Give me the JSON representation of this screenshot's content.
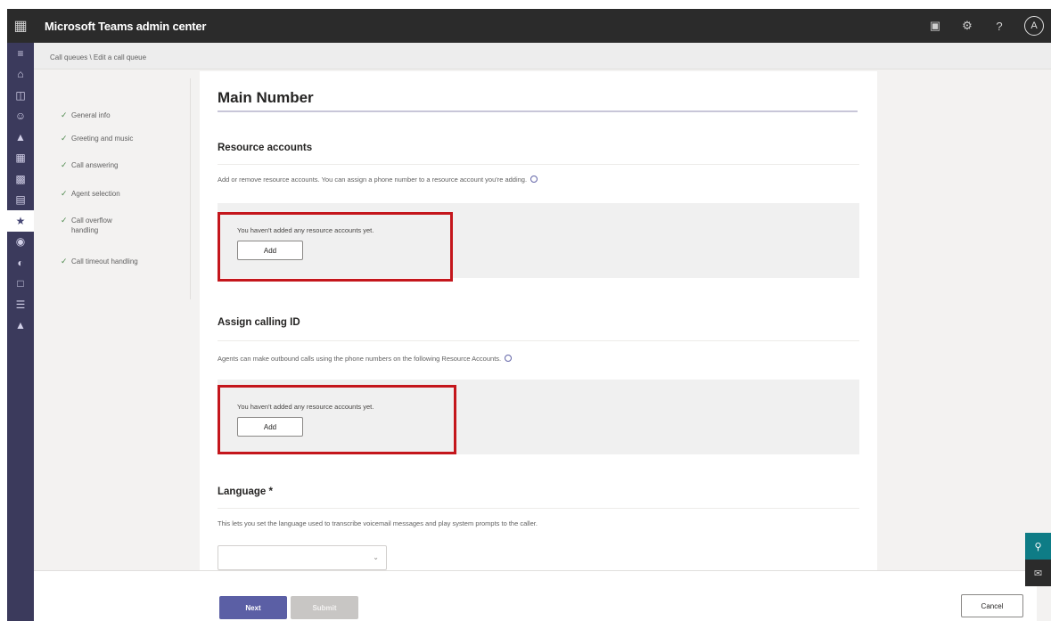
{
  "app": {
    "title": "Microsoft Teams admin center",
    "avatar_initial": "A"
  },
  "breadcrumb": "Call queues \\ Edit a call queue",
  "steps": [
    {
      "label": "General info"
    },
    {
      "label": "Greeting and music"
    },
    {
      "label": "Call answering"
    },
    {
      "label": "Agent selection"
    },
    {
      "label": "Call overflow handling"
    },
    {
      "label": "Call timeout handling"
    }
  ],
  "main": {
    "title": "Main Number",
    "resource_accounts": {
      "heading": "Resource accounts",
      "description": "Add or remove resource accounts. You can assign a phone number to a resource account you're adding.",
      "empty_text": "You haven't added any resource accounts yet.",
      "add_label": "Add"
    },
    "calling_id": {
      "heading": "Assign calling ID",
      "description": "Agents can make outbound calls using the phone numbers on the following Resource Accounts.",
      "empty_text": "You haven't added any resource accounts yet.",
      "add_label": "Add"
    },
    "language": {
      "heading": "Language *",
      "description": "This lets you set the language used to transcribe voicemail messages and play system prompts to the caller.",
      "selected": ""
    }
  },
  "footer": {
    "next_label": "Next",
    "submit_label": "Submit",
    "cancel_label": "Cancel"
  },
  "icons": {
    "waffle": "app-launcher-icon",
    "topbar": [
      "calendar-icon",
      "settings-icon",
      "help-icon"
    ],
    "rail": [
      "menu-icon",
      "dashboard-icon",
      "teams-icon",
      "users-icon",
      "deployment-icon",
      "teams-devices-icon",
      "teams-apps-icon",
      "meetings-icon",
      "voice-icon",
      "locations-icon",
      "policy-packages-icon",
      "planning-icon",
      "analytics-icon",
      "notifications-icon"
    ]
  },
  "colors": {
    "accent": "#6264a7",
    "highlight": "#c4161c",
    "rail": "#3b3a5c",
    "topbar": "#2b2b2b"
  }
}
